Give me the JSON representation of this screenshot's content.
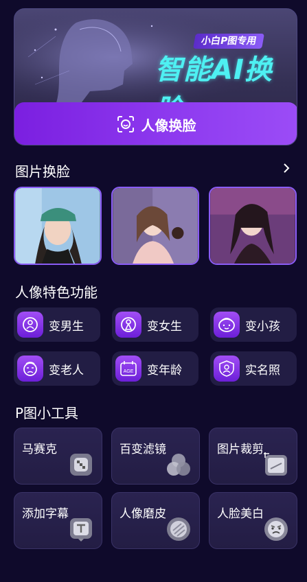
{
  "hero": {
    "tag": "小白P图专用",
    "title": "智能AI换脸",
    "button_label": "人像换脸"
  },
  "photo_swap": {
    "title": "图片换脸",
    "more_icon": "chevron-right-icon",
    "photos": [
      {
        "name": "photo-1"
      },
      {
        "name": "photo-2"
      },
      {
        "name": "photo-3"
      }
    ]
  },
  "features": {
    "title": "人像特色功能",
    "items": [
      {
        "label": "变男生",
        "icon": "male-icon"
      },
      {
        "label": "变女生",
        "icon": "female-icon"
      },
      {
        "label": "变小孩",
        "icon": "child-icon"
      },
      {
        "label": "变老人",
        "icon": "elder-icon"
      },
      {
        "label": "变年龄",
        "icon": "age-icon"
      },
      {
        "label": "实名照",
        "icon": "id-photo-icon"
      }
    ]
  },
  "tools": {
    "title": "P图小工具",
    "items": [
      {
        "label": "马赛克",
        "icon": "mosaic-icon"
      },
      {
        "label": "百变滤镜",
        "icon": "filter-icon"
      },
      {
        "label": "图片裁剪",
        "icon": "crop-icon"
      },
      {
        "label": "添加字幕",
        "icon": "subtitle-icon"
      },
      {
        "label": "人像磨皮",
        "icon": "smooth-skin-icon"
      },
      {
        "label": "人脸美白",
        "icon": "whitening-icon"
      }
    ]
  },
  "colors": {
    "background": "#0f0a2b",
    "accent": "#8f3cf0",
    "hero_title": "#4ef0f2"
  }
}
